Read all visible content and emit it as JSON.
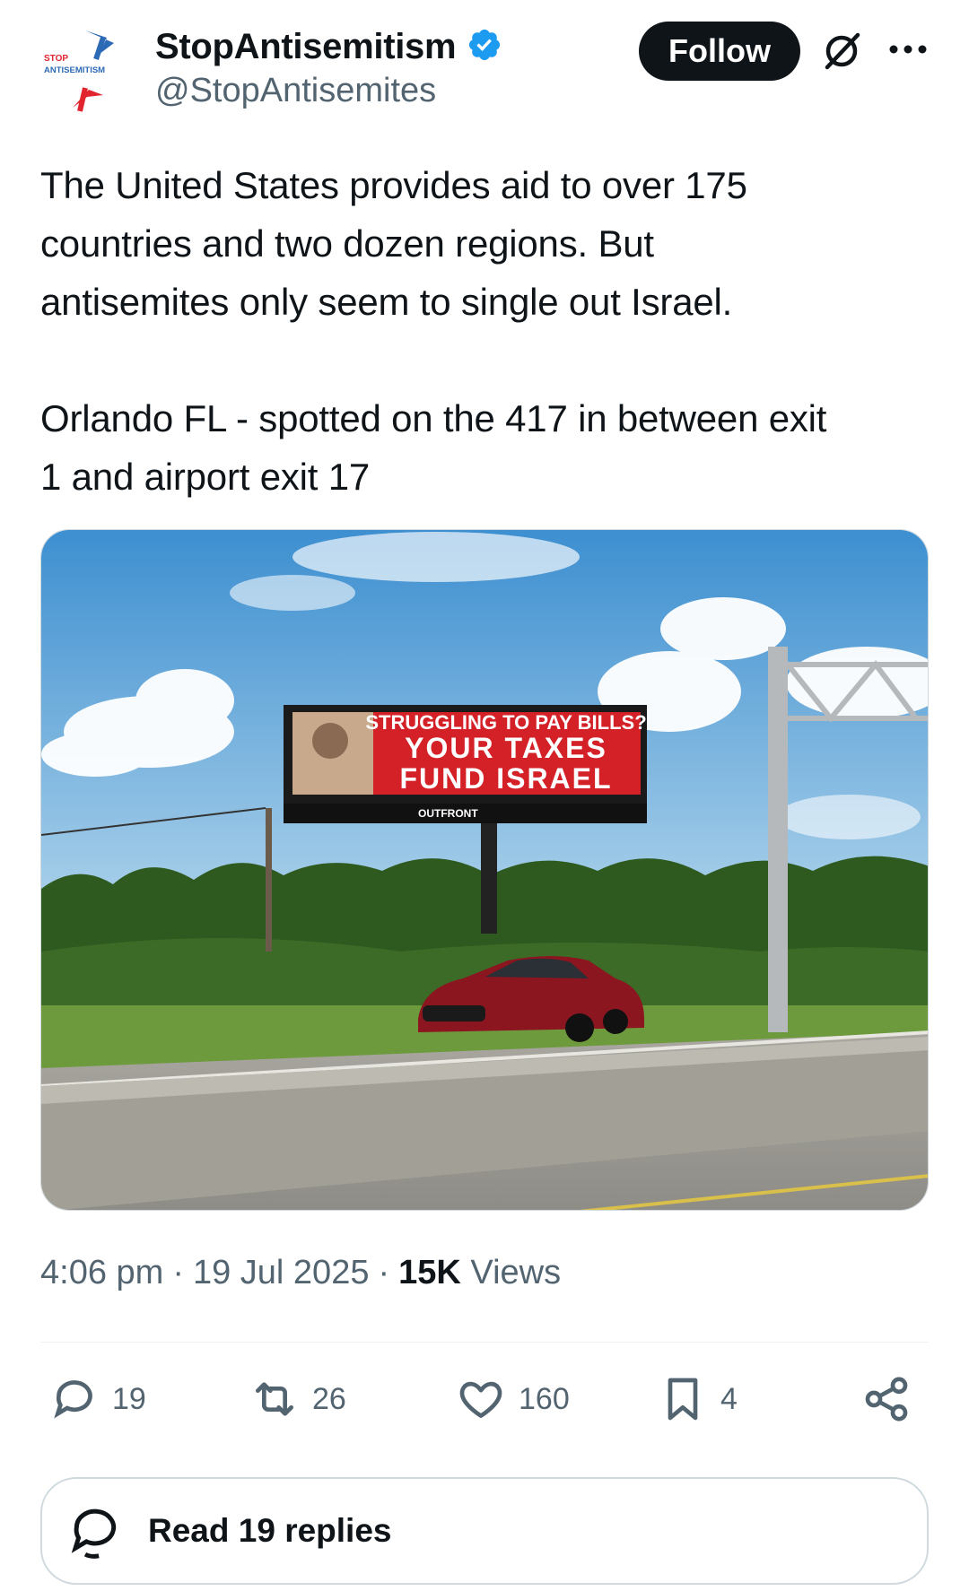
{
  "header": {
    "logo_text_top": "STOP",
    "logo_text_bottom": "ANTISEMITISM",
    "display_name": "StopAntisemitism",
    "handle": "@StopAntisemites",
    "follow_label": "Follow",
    "colors": {
      "brand_blue": "#2d6ab5",
      "brand_red": "#e0252e",
      "verified": "#1d9bf0"
    }
  },
  "tweet": {
    "text": "The United States provides aid to over 175\ncountries and two dozen regions. But\nantisemites only seem to single out Israel.\n\nOrlando FL - spotted on the 417 in between exit\n1 and airport exit 17"
  },
  "media": {
    "billboard_line1": "STRUGGLING TO PAY BILLS?",
    "billboard_line2": "YOUR TAXES",
    "billboard_line3": "FUND ISRAEL",
    "billboard_brand": "OUTFRONT"
  },
  "meta": {
    "time": "4:06 pm",
    "date": "19 Jul 2025",
    "views_count": "15K",
    "views_label": "Views"
  },
  "actions": {
    "replies": "19",
    "reposts": "26",
    "likes": "160",
    "bookmarks": "4"
  },
  "read_replies_label": "Read 19 replies"
}
